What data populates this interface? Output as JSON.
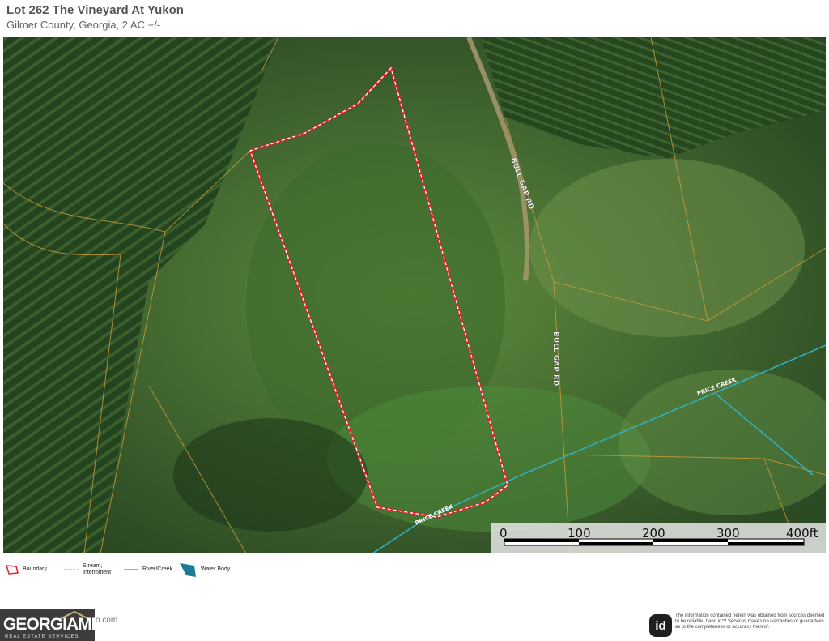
{
  "header": {
    "title": "Lot 262 The Vineyard At Yukon",
    "subtitle": "Gilmer County, Georgia, 2 AC +/-"
  },
  "map": {
    "road_labels": [
      "BULL GAP RD",
      "BULL GAP RD"
    ],
    "creek_labels": [
      "PRICE CREEK",
      "PRICE CREEK"
    ],
    "colors": {
      "boundary": "#e3202a",
      "river": "#2fb3c8",
      "parcel_lines": "#c79a3a",
      "forest_dark": "#1f3a1c",
      "forest_light": "#4f7a35"
    }
  },
  "scale": {
    "labels": [
      "0",
      "100",
      "200",
      "300",
      "400ft"
    ]
  },
  "legend": {
    "items": [
      {
        "label": "Boundary",
        "icon": "boundary-icon"
      },
      {
        "label": "Stream, Intermittent",
        "icon": "stream-icon"
      },
      {
        "label": "River/Creek",
        "icon": "river-icon"
      },
      {
        "label": "Water Body",
        "icon": "water-body-icon"
      }
    ]
  },
  "footer": {
    "logo_text": "GEORGIAMLS",
    "logo_sub": "REAL ESTATE SERVICES",
    "logo_suffix": "o.com",
    "id_badge": "id",
    "disclaimer": "The information contained herein was obtained from sources deemed to be reliable. Land id™ Services makes no warranties or guarantees as to the completeness or accuracy thereof."
  }
}
